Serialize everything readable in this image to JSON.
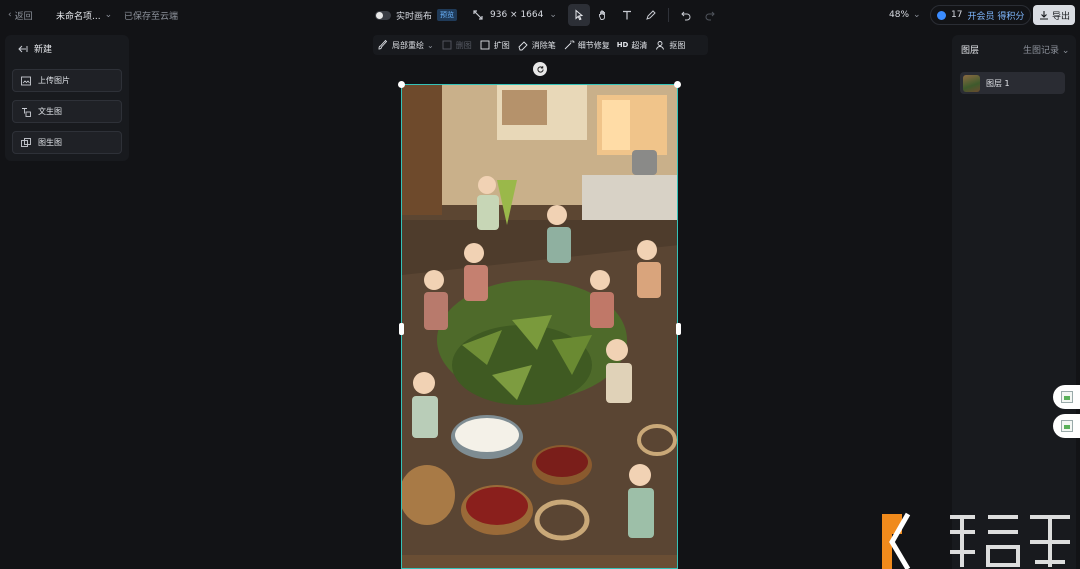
{
  "topbar": {
    "back_label": "返回",
    "project_title": "未命名项...",
    "saved_status": "已保存至云端",
    "live_canvas_label": "实时画布",
    "live_canvas_badge": "预览",
    "canvas_size": "936 × 1664",
    "zoom": "48%",
    "credits_count": "17",
    "credits_text": "开会员 得积分",
    "export_label": "导出"
  },
  "left_panel": {
    "heading": "新建",
    "buttons": [
      {
        "label": "上传图片",
        "icon": "upload-image-icon"
      },
      {
        "label": "文生图",
        "icon": "text-to-image-icon"
      },
      {
        "label": "图生图",
        "icon": "image-to-image-icon"
      }
    ]
  },
  "canvas_toolbar": {
    "items": [
      {
        "label": "局部重绘",
        "icon": "brush-icon",
        "enabled": true
      },
      {
        "label": "删图",
        "icon": "delete-image-icon",
        "enabled": false
      },
      {
        "label": "扩图",
        "icon": "expand-icon",
        "enabled": true
      },
      {
        "label": "消除笔",
        "icon": "eraser-icon",
        "enabled": true
      },
      {
        "label": "细节修复",
        "icon": "magic-icon",
        "enabled": true
      },
      {
        "label": "超清",
        "tag": "HD",
        "enabled": true
      },
      {
        "label": "抠图",
        "icon": "cutout-icon",
        "enabled": true
      }
    ]
  },
  "right_panel": {
    "tab_layers": "图层",
    "tab_history": "生图记录",
    "layers": [
      {
        "label": "图层 1"
      }
    ]
  },
  "colors": {
    "background": "#121316",
    "panel": "#181a1e",
    "selection": "#35c2b8",
    "accent": "#3b8cff"
  }
}
